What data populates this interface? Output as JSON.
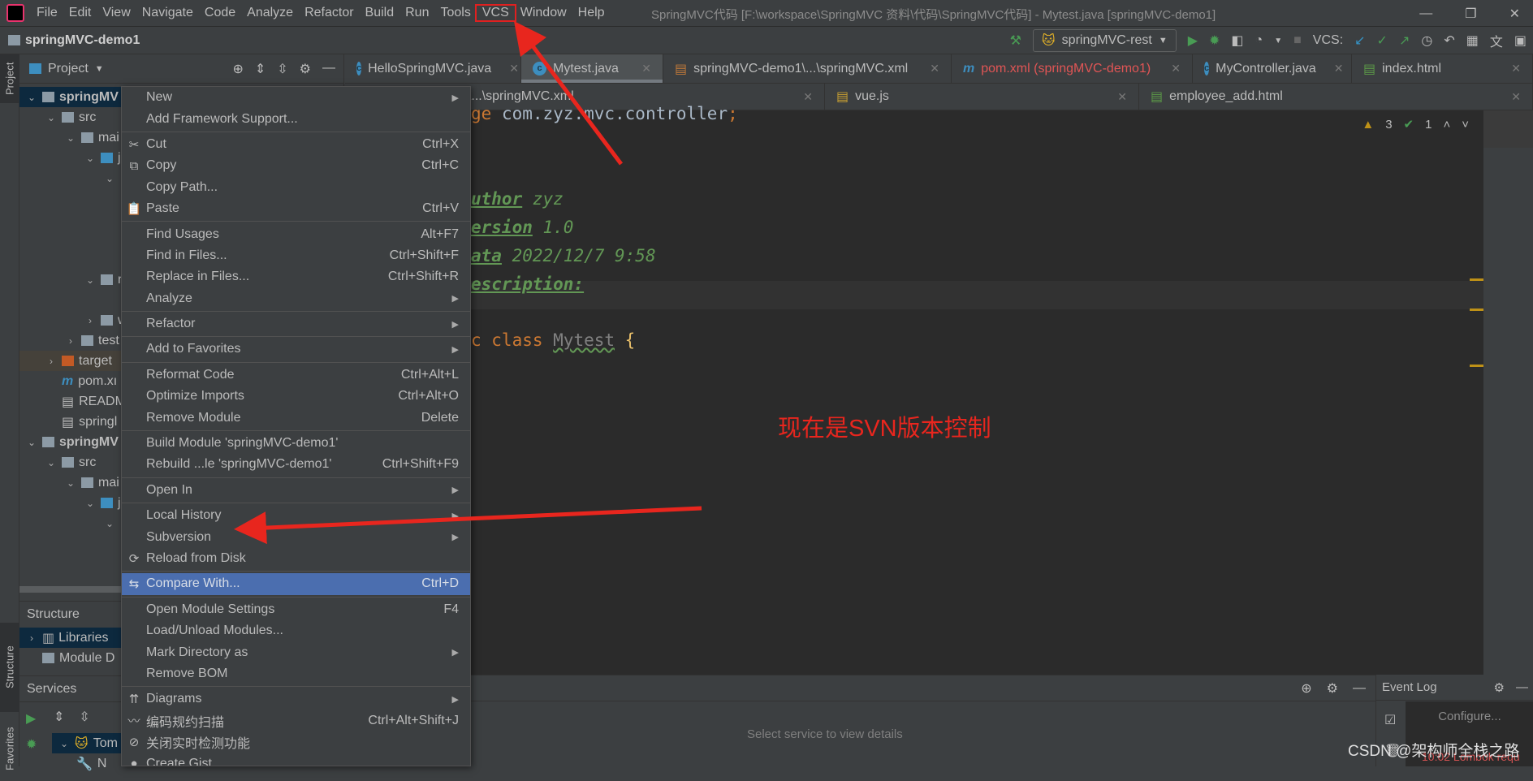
{
  "menubar": {
    "items": [
      "File",
      "Edit",
      "View",
      "Navigate",
      "Code",
      "Analyze",
      "Refactor",
      "Build",
      "Run",
      "Tools",
      "VCS",
      "Window",
      "Help"
    ],
    "highlighted": "VCS"
  },
  "window_title": "SpringMVC代码 [F:\\workspace\\SpringMVC 资料\\代码\\SpringMVC代码] - Mytest.java [springMVC-demo1]",
  "toolbar": {
    "project": "springMVC-demo1",
    "run_config": "springMVC-rest",
    "vcs_label": "VCS:"
  },
  "project_panel": {
    "title": "Project",
    "tree": [
      {
        "label": "springMV",
        "depth": 0,
        "arrow": "down",
        "icon": "module",
        "sel": true,
        "bold": true
      },
      {
        "label": "src",
        "depth": 1,
        "arrow": "down",
        "icon": "folder"
      },
      {
        "label": "mai",
        "depth": 2,
        "arrow": "down",
        "icon": "folder"
      },
      {
        "label": "j",
        "depth": 3,
        "arrow": "down",
        "icon": "folder-blue"
      },
      {
        "label": "",
        "depth": 4,
        "arrow": "down",
        "icon": "none"
      },
      {
        "label": "",
        "depth": 5,
        "arrow": "",
        "icon": "none"
      },
      {
        "label": "",
        "depth": 5,
        "arrow": "",
        "icon": "none"
      },
      {
        "label": "",
        "depth": 5,
        "arrow": "",
        "icon": "none"
      },
      {
        "label": "",
        "depth": 5,
        "arrow": "",
        "icon": "none"
      },
      {
        "label": "r",
        "depth": 3,
        "arrow": "down",
        "icon": "folder"
      },
      {
        "label": "",
        "depth": 4,
        "arrow": "",
        "icon": "none"
      },
      {
        "label": "w",
        "depth": 3,
        "arrow": "right",
        "icon": "folder"
      },
      {
        "label": "test",
        "depth": 2,
        "arrow": "right",
        "icon": "folder"
      },
      {
        "label": "target",
        "depth": 1,
        "arrow": "right",
        "icon": "folder-orange",
        "tgt": true
      },
      {
        "label": "pom.xı",
        "depth": 1,
        "arrow": "",
        "icon": "maven"
      },
      {
        "label": "READM",
        "depth": 1,
        "arrow": "",
        "icon": "file"
      },
      {
        "label": "springl",
        "depth": 1,
        "arrow": "",
        "icon": "file"
      },
      {
        "label": "springMV",
        "depth": 0,
        "arrow": "down",
        "icon": "module",
        "bold": true
      },
      {
        "label": "src",
        "depth": 1,
        "arrow": "down",
        "icon": "folder"
      },
      {
        "label": "mai",
        "depth": 2,
        "arrow": "down",
        "icon": "folder"
      },
      {
        "label": "j",
        "depth": 3,
        "arrow": "down",
        "icon": "folder-blue"
      },
      {
        "label": "",
        "depth": 4,
        "arrow": "down",
        "icon": "none"
      }
    ]
  },
  "structure_panel": {
    "title": "Structure",
    "items": [
      "Libraries",
      "Module D"
    ]
  },
  "services_panel": {
    "title": "Services",
    "tree": [
      "Tom",
      "N"
    ],
    "placeholder": "Select service to view details"
  },
  "left_strip": {
    "project": "Project",
    "structure": "Structure",
    "favorites": "Favorites"
  },
  "tabs_row1": [
    {
      "label": "HelloSpringMVC.java",
      "icon": "c"
    },
    {
      "label": "Mytest.java",
      "icon": "c",
      "active": true
    },
    {
      "label": "springMVC-demo1\\...\\springMVC.xml",
      "icon": "xml"
    },
    {
      "label": "pom.xml (springMVC-demo1)",
      "icon": "m",
      "red": true
    },
    {
      "label": "MyController.java",
      "icon": "c"
    },
    {
      "label": "index.html",
      "icon": "html"
    }
  ],
  "tabs_row2": [
    {
      "label": "SpringMVC-rest\\...\\springMVC.xml",
      "icon": "xml"
    },
    {
      "label": "vue.js",
      "icon": "js"
    },
    {
      "label": "employee_add.html",
      "icon": "html"
    }
  ],
  "editor": {
    "lines": [
      {
        "parts": [
          [
            "kw",
            "ge"
          ],
          [
            "plain",
            " com.zyz.mvc.controller"
          ],
          [
            "kw",
            ";"
          ]
        ]
      },
      {
        "parts": [
          [
            "doc tag",
            "uthor"
          ],
          [
            "doc",
            " zyz"
          ]
        ]
      },
      {
        "parts": [
          [
            "doc tag",
            "ersion"
          ],
          [
            "doc",
            " 1.0"
          ]
        ]
      },
      {
        "parts": [
          [
            "doc tag",
            "ata"
          ],
          [
            "doc",
            " 2022/12/7 9:58"
          ]
        ]
      },
      {
        "parts": [
          [
            "doc tag",
            "escription:"
          ]
        ]
      },
      {
        "parts": [
          [
            "kw",
            "c class "
          ],
          [
            "cls",
            "Mytest"
          ],
          [
            "brace",
            " {"
          ]
        ]
      }
    ],
    "warnings": "3",
    "weak_warnings": "1"
  },
  "annotation": "现在是SVN版本控制",
  "context_menu": [
    {
      "label": "New",
      "sub": true
    },
    {
      "label": "Add Framework Support..."
    },
    {
      "sep": true
    },
    {
      "label": "Cut",
      "icon": "✂",
      "sc": "Ctrl+X"
    },
    {
      "label": "Copy",
      "icon": "⧉",
      "sc": "Ctrl+C"
    },
    {
      "label": "Copy Path..."
    },
    {
      "label": "Paste",
      "icon": "📋",
      "sc": "Ctrl+V"
    },
    {
      "sep": true
    },
    {
      "label": "Find Usages",
      "sc": "Alt+F7"
    },
    {
      "label": "Find in Files...",
      "sc": "Ctrl+Shift+F"
    },
    {
      "label": "Replace in Files...",
      "sc": "Ctrl+Shift+R"
    },
    {
      "label": "Analyze",
      "sub": true
    },
    {
      "sep": true
    },
    {
      "label": "Refactor",
      "sub": true
    },
    {
      "sep": true
    },
    {
      "label": "Add to Favorites",
      "sub": true
    },
    {
      "sep": true
    },
    {
      "label": "Reformat Code",
      "sc": "Ctrl+Alt+L"
    },
    {
      "label": "Optimize Imports",
      "sc": "Ctrl+Alt+O"
    },
    {
      "label": "Remove Module",
      "sc": "Delete"
    },
    {
      "sep": true
    },
    {
      "label": "Build Module 'springMVC-demo1'"
    },
    {
      "label": "Rebuild ...le 'springMVC-demo1'",
      "sc": "Ctrl+Shift+F9"
    },
    {
      "sep": true
    },
    {
      "label": "Open In",
      "sub": true
    },
    {
      "sep": true
    },
    {
      "label": "Local History",
      "sub": true
    },
    {
      "label": "Subversion",
      "sub": true
    },
    {
      "label": "Reload from Disk",
      "icon": "⟳"
    },
    {
      "sep": true
    },
    {
      "label": "Compare With...",
      "icon": "⇆",
      "sc": "Ctrl+D",
      "hl": true
    },
    {
      "sep": true
    },
    {
      "label": "Open Module Settings",
      "sc": "F4"
    },
    {
      "label": "Load/Unload Modules..."
    },
    {
      "label": "Mark Directory as",
      "sub": true
    },
    {
      "label": "Remove BOM"
    },
    {
      "sep": true
    },
    {
      "label": "Diagrams",
      "icon": "⇈",
      "sub": true
    },
    {
      "label": "编码规约扫描",
      "icon": "〰",
      "sc": "Ctrl+Alt+Shift+J"
    },
    {
      "label": "关闭实时检测功能",
      "icon": "⊘"
    },
    {
      "label": "Create Gist...",
      "icon": "●"
    }
  ],
  "event_log": {
    "title": "Event Log",
    "configure": "Configure...",
    "entry": "10:02  Lombok requ"
  },
  "watermark": "CSDN @架构师全栈之路",
  "colors": {
    "accent": "#4b6eaf",
    "annotation": "#e8261e",
    "keyword": "#cc7832",
    "doc": "#629755"
  }
}
